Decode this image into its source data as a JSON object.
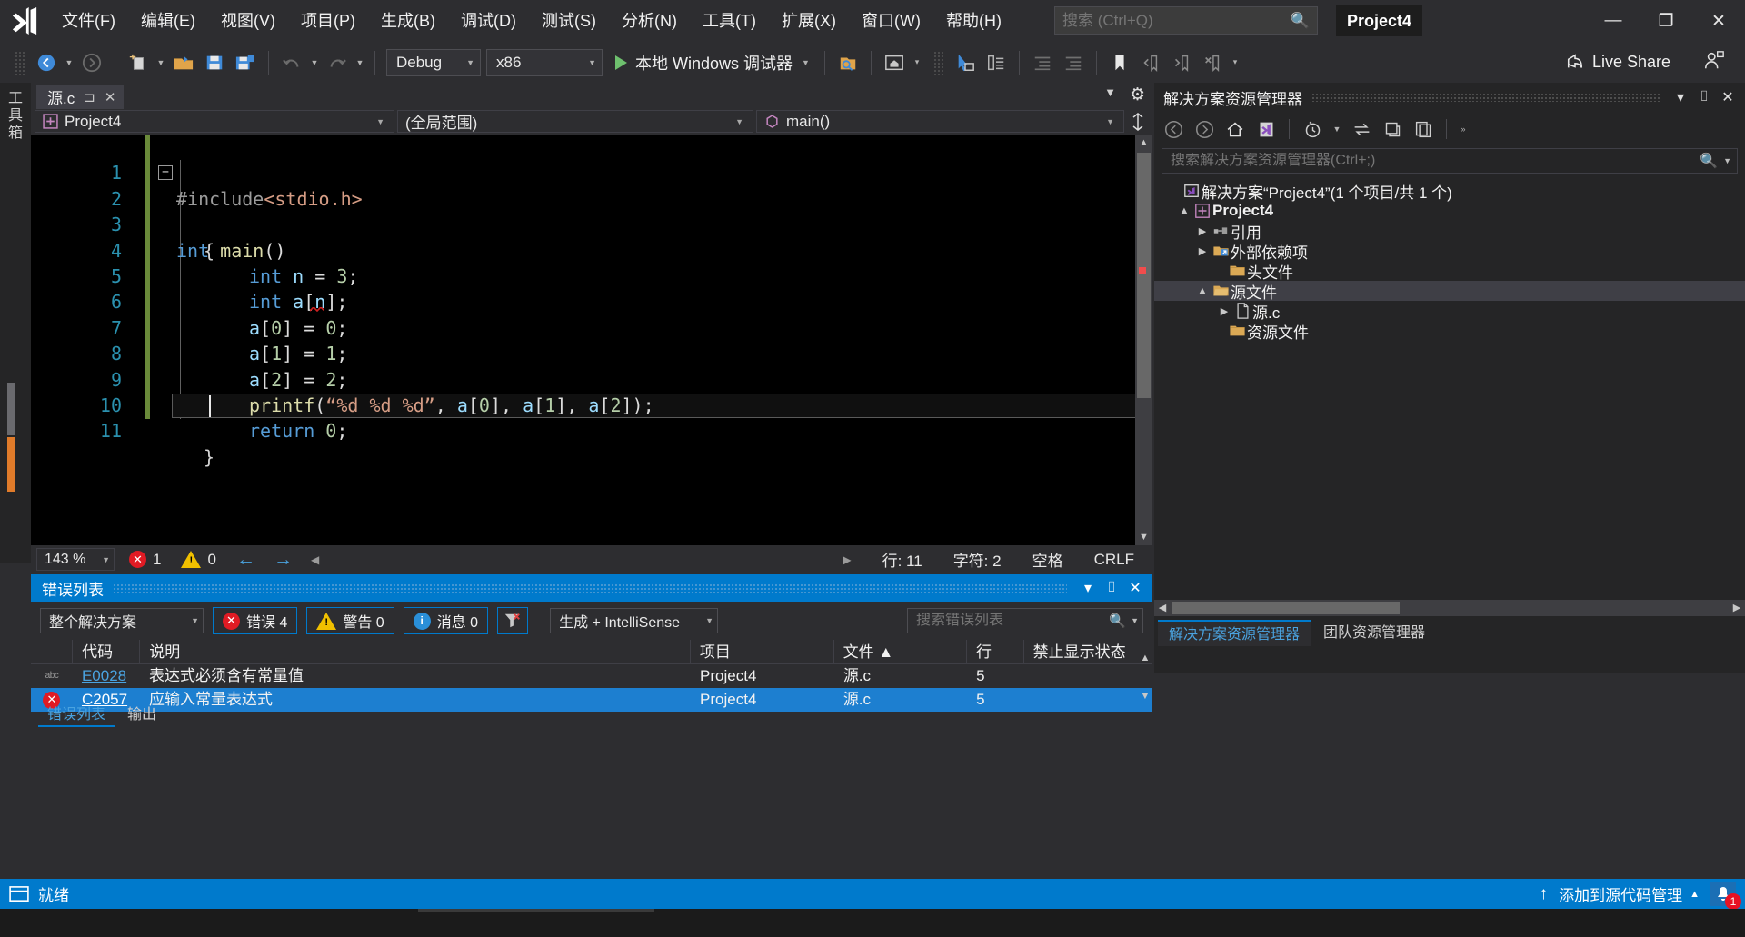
{
  "app": {
    "product_icon": "visual-studio-logo",
    "project_title": "Project4"
  },
  "menu": {
    "items": [
      {
        "label": "文件(F)"
      },
      {
        "label": "编辑(E)"
      },
      {
        "label": "视图(V)"
      },
      {
        "label": "项目(P)"
      },
      {
        "label": "生成(B)"
      },
      {
        "label": "调试(D)"
      },
      {
        "label": "测试(S)"
      },
      {
        "label": "分析(N)"
      },
      {
        "label": "工具(T)"
      },
      {
        "label": "扩展(X)"
      },
      {
        "label": "窗口(W)"
      },
      {
        "label": "帮助(H)"
      }
    ]
  },
  "quick_search": {
    "placeholder": "搜索 (Ctrl+Q)",
    "value": ""
  },
  "window_buttons": {
    "minimize": "—",
    "maximize": "❐",
    "close": "✕"
  },
  "toolbar": {
    "configuration": "Debug",
    "platform": "x86",
    "run_label": "本地 Windows 调试器",
    "live_share": "Live Share"
  },
  "toolbox": {
    "label": "工具箱"
  },
  "editor": {
    "tab": {
      "name": "源.c",
      "pin": "⊐",
      "close": "✕"
    },
    "nav": {
      "project": "Project4",
      "scope": "(全局范围)",
      "member": "main()"
    },
    "lines": [
      {
        "n": "1",
        "text": "#include<stdio.h>"
      },
      {
        "n": "2",
        "text": "int main()"
      },
      {
        "n": "3",
        "text": "{"
      },
      {
        "n": "4",
        "text": "    int n = 3;"
      },
      {
        "n": "5",
        "text": "    int a[n];"
      },
      {
        "n": "6",
        "text": "    a[0] = 0;"
      },
      {
        "n": "7",
        "text": "    a[1] = 1;"
      },
      {
        "n": "8",
        "text": "    a[2] = 2;"
      },
      {
        "n": "9",
        "text": "    printf(\"%d %d %d\", a[0], a[1], a[2]);"
      },
      {
        "n": "10",
        "text": "    return 0;"
      },
      {
        "n": "11",
        "text": "}"
      }
    ],
    "status": {
      "zoom": "143 %",
      "error_count": "1",
      "warning_count": "0",
      "line": "行: 11",
      "col": "字符: 2",
      "spaces": "空格",
      "eol": "CRLF"
    }
  },
  "solution_explorer": {
    "title": "解决方案资源管理器",
    "search_placeholder": "搜索解决方案资源管理器(Ctrl+;)",
    "header_buttons": {
      "dropdown": "▾",
      "pin": "⌷",
      "close": "✕"
    },
    "tree": [
      {
        "label": "解决方案“Project4”(1 个项目/共 1 个)",
        "indent": 0,
        "twisty": "",
        "icon": "solution-icon",
        "bold": false,
        "selected": false
      },
      {
        "label": "Project4",
        "indent": 1,
        "twisty": "▲",
        "icon": "project-icon",
        "bold": true,
        "selected": false
      },
      {
        "label": "引用",
        "indent": 2,
        "twisty": "▶",
        "icon": "references-icon",
        "bold": false,
        "selected": false
      },
      {
        "label": "外部依赖项",
        "indent": 2,
        "twisty": "▶",
        "icon": "ext-dep-icon",
        "bold": false,
        "selected": false
      },
      {
        "label": "头文件",
        "indent": 2,
        "twisty": "",
        "icon": "folder-icon",
        "bold": false,
        "selected": false
      },
      {
        "label": "源文件",
        "indent": 2,
        "twisty": "▲",
        "icon": "folder-icon",
        "bold": false,
        "selected": true
      },
      {
        "label": "源.c",
        "indent": 3,
        "twisty": "▶",
        "icon": "c-file-icon",
        "bold": false,
        "selected": false
      },
      {
        "label": "资源文件",
        "indent": 2,
        "twisty": "",
        "icon": "folder-icon",
        "bold": false,
        "selected": false
      }
    ],
    "tabs": [
      {
        "label": "解决方案资源管理器",
        "active": true
      },
      {
        "label": "团队资源管理器",
        "active": false
      }
    ]
  },
  "error_list": {
    "title": "错误列表",
    "header_buttons": {
      "dropdown": "▾",
      "pin": "⌷",
      "close": "✕"
    },
    "scope": "整个解决方案",
    "errors_toggle": "错误 4",
    "warnings_toggle": "警告 0",
    "messages_toggle": "消息 0",
    "build_filter": "生成 + IntelliSense",
    "search_placeholder": "搜索错误列表",
    "columns": [
      {
        "label": "",
        "key": "icon"
      },
      {
        "label": "代码",
        "key": "code"
      },
      {
        "label": "说明",
        "key": "desc"
      },
      {
        "label": "项目",
        "key": "project"
      },
      {
        "label": "文件 ▲",
        "key": "file"
      },
      {
        "label": "行",
        "key": "line"
      },
      {
        "label": "禁止显示状态",
        "key": "suppression"
      }
    ],
    "rows": [
      {
        "icon": "intellisense-icon",
        "code": "E0028",
        "desc": "表达式必须含有常量值",
        "project": "Project4",
        "file": "源.c",
        "line": "5",
        "suppression": "",
        "selected": false
      },
      {
        "icon": "error-icon",
        "code": "C2057",
        "desc": "应输入常量表达式",
        "project": "Project4",
        "file": "源.c",
        "line": "5",
        "suppression": "",
        "selected": true
      }
    ],
    "tabs": [
      {
        "label": "错误列表",
        "active": true
      },
      {
        "label": "输出",
        "active": false
      }
    ]
  },
  "status_bar": {
    "ready": "就绪",
    "source_control": "添加到源代码管理",
    "source_control_caret": "▲",
    "notification_count": "1"
  }
}
